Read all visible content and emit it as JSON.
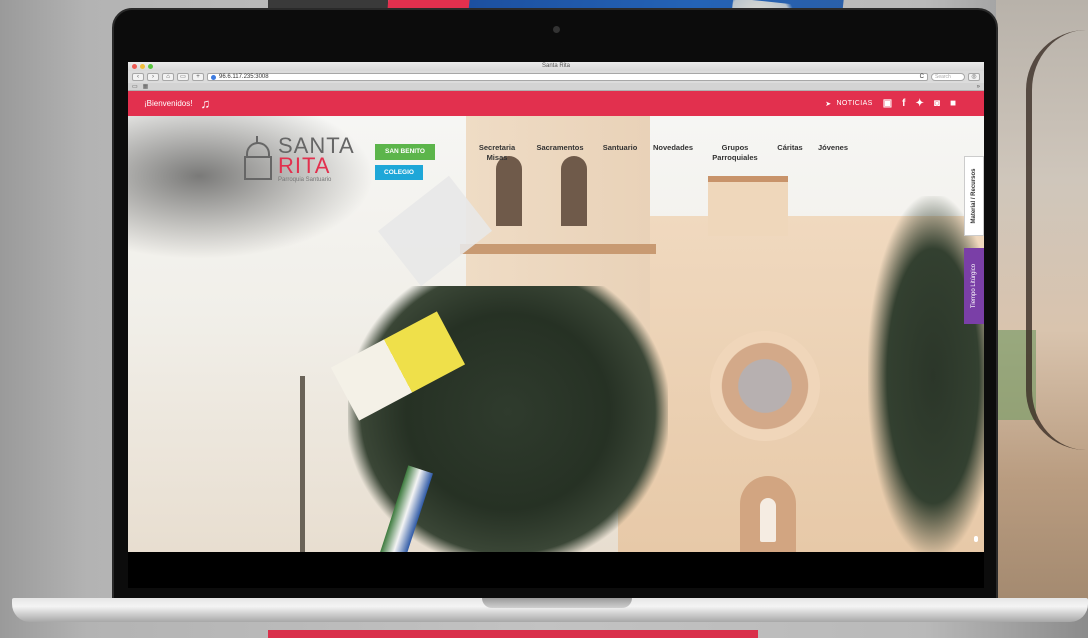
{
  "browser": {
    "window_title": "Santa Rita",
    "url": "96.6.117.235:3008",
    "search_placeholder": "Search",
    "reload_label": "C",
    "bookmarks_icon": "book-icon",
    "grid_icon": "grid-icon",
    "more_label": "»"
  },
  "topbar": {
    "welcome": "¡Bienvenidos!",
    "music_icon": "music-note-icon",
    "noticias": "NOTICIAS",
    "social": [
      "f",
      "t",
      "ig",
      "yt"
    ]
  },
  "logo": {
    "line1": "SANTA",
    "line2": "RITA",
    "tagline": "Parroquia Santuario"
  },
  "buttons": {
    "san_benito": "SAN BENITO",
    "colegio": "COLEGIO"
  },
  "nav": [
    {
      "label": "Secretaria\nMisas",
      "id": "secretaria-misas"
    },
    {
      "label": "Sacramentos",
      "id": "sacramentos"
    },
    {
      "label": "Santuario",
      "id": "santuario"
    },
    {
      "label": "Novedades",
      "id": "novedades"
    },
    {
      "label": "Grupos\nParroquiales",
      "id": "grupos-parroquiales"
    },
    {
      "label": "Cáritas",
      "id": "caritas"
    },
    {
      "label": "Jóvenes",
      "id": "jovenes"
    }
  ],
  "side_tabs": {
    "material": "Material / Recursos",
    "tiempo": "Tiempo Litúrgico"
  },
  "colors": {
    "brand_red": "#e2304e",
    "green_button": "#5cb54b",
    "blue_button": "#1ea7d8",
    "purple_tab": "#7a3fa7"
  }
}
